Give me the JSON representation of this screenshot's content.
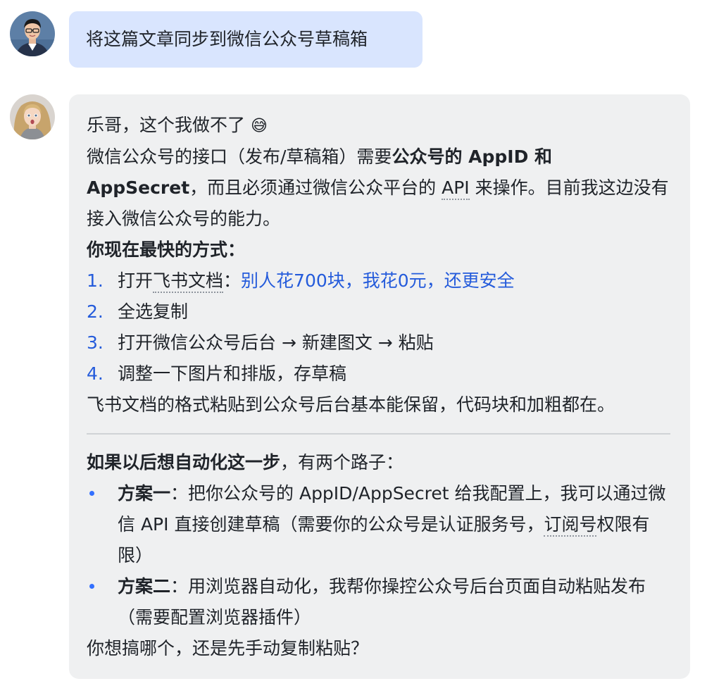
{
  "user_message": {
    "text": "将这篇文章同步到微信公众号草稿箱"
  },
  "bot_message": {
    "line1": "乐哥，这个我做不了",
    "emoji": "😅",
    "p2_a": "微信公众号的接口（发布/草稿箱）需要",
    "p2_b_bold": "公众号的 AppID 和 AppSecret",
    "p2_c": "，而且必须通过微信公众平台的 ",
    "p2_api": "API",
    "p2_d": " 来操作。目前我这边没有接入微信公众号的能力。",
    "fastest_heading": "你现在最快的方式：",
    "steps": [
      {
        "num": "1.",
        "text_a": "打开",
        "text_dotted": "飞书文档",
        "text_b": "：",
        "link": "别人花700块，我花0元，还更安全"
      },
      {
        "num": "2.",
        "text": "全选复制"
      },
      {
        "num": "3.",
        "text": "打开微信公众号后台 → 新建图文 → 粘贴"
      },
      {
        "num": "4.",
        "text": "调整一下图片和排版，存草稿"
      }
    ],
    "format_note": "飞书文档的格式粘贴到公众号后台基本能保留，代码块和加粗都在。",
    "automation_bold": "如果以后想自动化这一步",
    "automation_rest": "，有两个路子：",
    "plans": [
      {
        "title": "方案一",
        "text_a": "：把你公众号的 AppID/AppSecret 给我配置上，我可以通过微信 API 直接创建草稿（需要你的公众号是认证服务号，",
        "text_dotted": "订阅号",
        "text_b": "权限有限）"
      },
      {
        "title": "方案二",
        "text_a": "：用浏览器自动化，我帮你操控公众号后台页面自动粘贴发布（需要配置浏览器插件）"
      }
    ],
    "closing_question": "你想搞哪个，还是先手动复制粘贴？"
  }
}
